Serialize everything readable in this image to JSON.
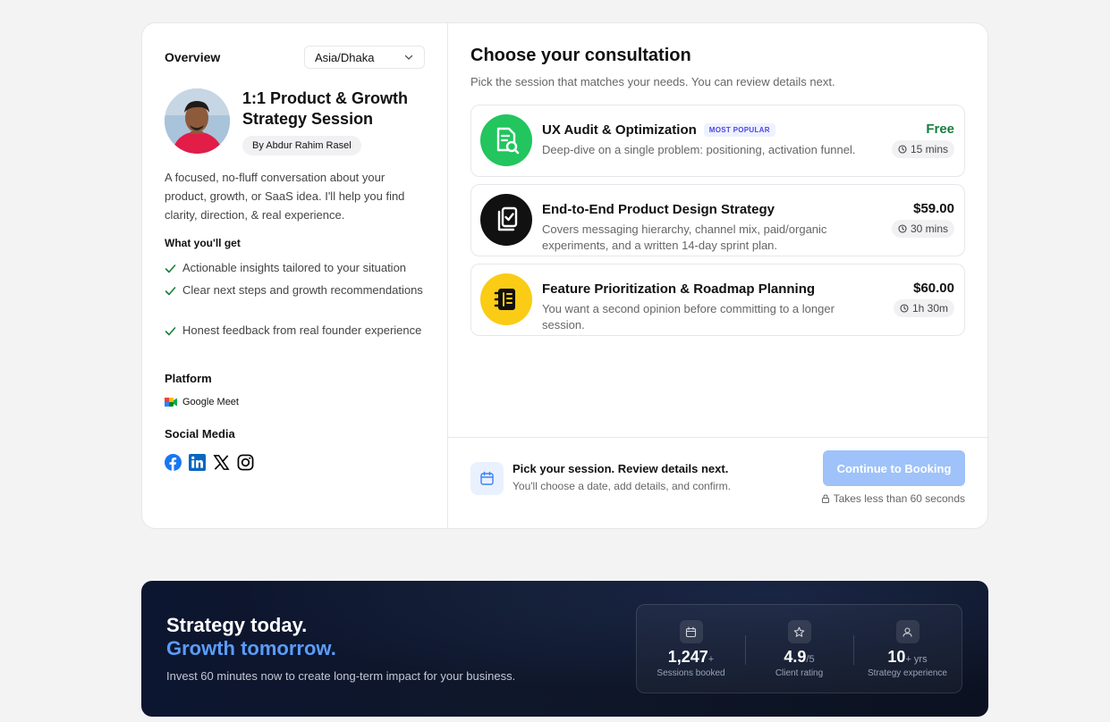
{
  "overview": {
    "title": "Overview",
    "timezone": "Asia/Dhaka",
    "host_name": "1:1 Product & Growth Strategy Session",
    "by": "By Abdur Rahim Rasel",
    "description": "A focused, no-fluff conversation about your product, growth, or SaaS idea. I'll help you find clarity, direction, & real experience.",
    "what_heading": "What you'll get",
    "benefits": [
      "Actionable insights tailored to your situation",
      "Clear next steps and growth recommendations",
      "Honest feedback from real founder experience"
    ],
    "platform_heading": "Platform",
    "platform": "Google Meet",
    "social_heading": "Social Media",
    "socials": [
      "facebook-icon",
      "linkedin-icon",
      "x-icon",
      "instagram-icon"
    ]
  },
  "consultation": {
    "title": "Choose your consultation",
    "subtitle": "Pick the session that matches your needs. You can review details next.",
    "services": [
      {
        "title": "UX Audit & Optimization",
        "badge": "MOST POPULAR",
        "desc": "Deep-dive on a single problem: positioning, activation funnel.",
        "price": "Free",
        "duration": "15 mins",
        "icon": "document-search-icon",
        "color": "#22c55e"
      },
      {
        "title": "End-to-End Product Design Strategy",
        "badge": "",
        "desc": "Covers messaging hierarchy, channel mix, paid/organic experiments, and a written 14-day sprint plan.",
        "price": "$59.00",
        "duration": "30 mins",
        "icon": "checklist-stack-icon",
        "color": "#111111"
      },
      {
        "title": "Feature Prioritization & Roadmap Planning",
        "badge": "",
        "desc": "You want a second opinion before committing to a longer session.",
        "price": "$60.00",
        "duration": "1h 30m",
        "icon": "notebook-icon",
        "color": "#facc15"
      }
    ]
  },
  "footer": {
    "title": "Pick your session. Review details next.",
    "subtitle": "You'll choose a date, add details, and confirm.",
    "cta": "Continue to Booking",
    "takes": "Takes less than 60 seconds"
  },
  "banner": {
    "line1": "Strategy today.",
    "line2": "Growth tomorrow.",
    "sub": "Invest 60 minutes now to create long-term impact for your business.",
    "stats": [
      {
        "value": "1,247",
        "suffix": "+",
        "label": "Sessions booked",
        "icon": "calendar-icon"
      },
      {
        "value": "4.9",
        "suffix": "/5",
        "label": "Client rating",
        "icon": "star-icon"
      },
      {
        "value": "10",
        "suffix": "+ yrs",
        "label": "Strategy experience",
        "icon": "user-icon"
      }
    ]
  },
  "colors": {
    "accent": "#2563eb",
    "cta_disabled": "#9ec2f9",
    "free": "#15803d",
    "banner_highlight": "#5b9cf8"
  }
}
